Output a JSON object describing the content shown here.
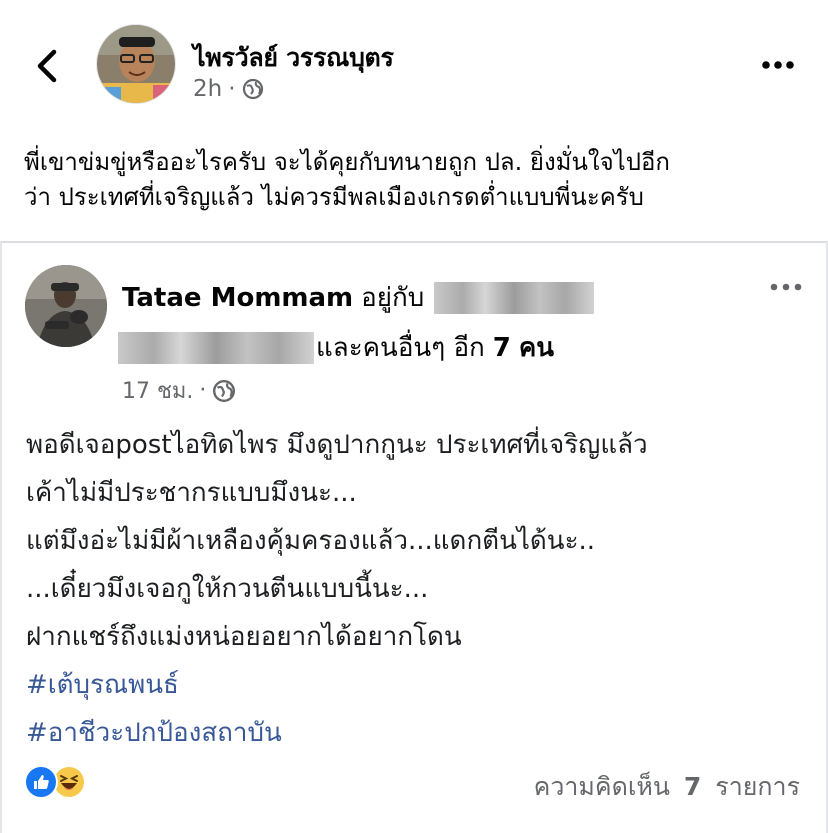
{
  "header": {
    "back_icon": "chevron-left-icon",
    "author_name": "ไพรวัลย์ วรรณบุตร",
    "time": "2h",
    "separator": "·",
    "privacy_icon": "globe-icon",
    "more_icon": "more-horizontal-icon"
  },
  "post": {
    "lines": [
      "พี่เขาข่มขู่หรืออะไรครับ จะได้คุยกับทนายถูก ปล. ยิ่งมั่นใจไปอีก",
      "ว่า ประเทศที่เจริญแล้ว ไม่ควรมีพลเมืองเกรดต่ำแบบพี่นะครับ"
    ]
  },
  "shared": {
    "name": "Tatae Mommam",
    "with_text": "อยู่กับ",
    "others_text": "และคนอื่นๆ อีก",
    "others_count": "7",
    "others_unit": "คน",
    "time": "17 ชม.",
    "separator": "·",
    "privacy_icon": "globe-icon",
    "more_icon": "more-horizontal-icon",
    "body_lines": [
      "พอดีเจอpostไอทิดไพร มึงดูปากกูนะ ประเทศที่เจริญแล้ว",
      "เค้าไม่มีประชากรแบบมึงนะ...",
      "แต่มึงอ่ะไม่มีผ้าเหลืองคุ้มครองแล้ว...แดกตีนได้นะ..",
      "...เดี๋ยวมึงเจอกูให้กวนตีนแบบนี้นะ...",
      "ฝากแชร์ถึงแม่งหน่อยอยากได้อยากโดน"
    ],
    "hashtags": [
      "#เต้บุรณพนธ์",
      "#อาชีวะปกป้องสถาบัน"
    ],
    "reactions": [
      "like-icon",
      "haha-icon"
    ],
    "comments_label": "ความคิดเห็น",
    "comments_count": "7",
    "comments_unit": "รายการ"
  }
}
